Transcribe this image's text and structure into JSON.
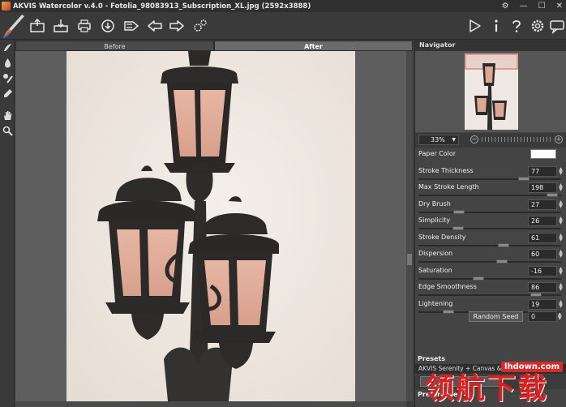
{
  "window": {
    "title": "AKVIS Watercolor v.4.0 - Fotolia_98083913_Subscription_XL.jpg (2592x3888)",
    "controls": [
      "⚙",
      "—",
      "☐",
      "✕"
    ]
  },
  "view_tabs": {
    "before": "Before",
    "after": "After"
  },
  "navigator": {
    "title": "Navigator",
    "zoom": "33%"
  },
  "params": {
    "paper_color_label": "Paper Color",
    "items": [
      {
        "label": "Stroke Thickness",
        "value": "77",
        "level": 0.77
      },
      {
        "label": "Max Stroke Length",
        "value": "198",
        "level": 0.99
      },
      {
        "label": "Dry Brush",
        "value": "27",
        "level": 0.27
      },
      {
        "label": "Simplicity",
        "value": "26",
        "level": 0.26
      },
      {
        "label": "Stroke Density",
        "value": "61",
        "level": 0.61
      },
      {
        "label": "Dispersion",
        "value": "60",
        "level": 0.6
      },
      {
        "label": "Saturation",
        "value": "-16",
        "level": 0.42
      },
      {
        "label": "Edge Smoothness",
        "value": "86",
        "level": 0.86
      },
      {
        "label": "Lightening",
        "value": "19",
        "level": 0.19
      }
    ],
    "random_seed_label": "Random Seed",
    "random_seed_value": "0"
  },
  "presets": {
    "title": "Presets",
    "current": "AKVIS Serenity + Canvas & Vign"
  },
  "preferences": {
    "title": "Preferences"
  },
  "watermark": {
    "url": "lhdown.com",
    "text": "领航下载"
  },
  "colors": {
    "paper": "#ffffff",
    "panel": "#444444",
    "canvas_bg": "#5e5e5e"
  }
}
